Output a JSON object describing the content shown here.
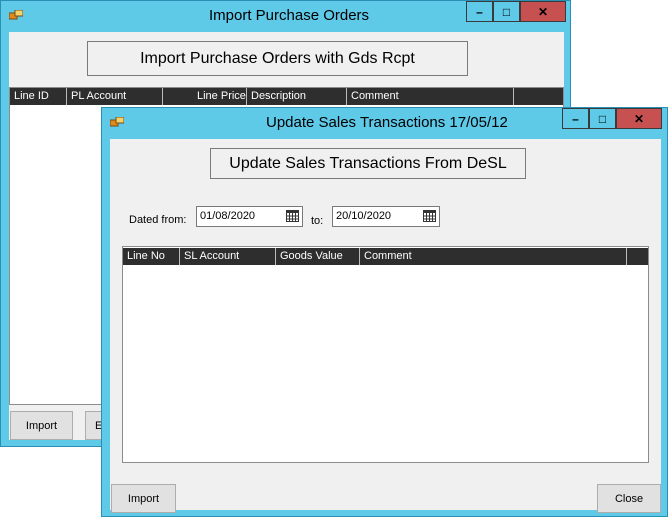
{
  "back_window": {
    "title": "Import Purchase Orders",
    "banner": "Import Purchase Orders with Gds Rcpt",
    "columns": [
      "Line ID",
      "PL Account",
      "",
      "Line Price",
      "Description",
      "Comment"
    ],
    "buttons": {
      "import": "Import",
      "export": "Ex"
    },
    "title_buttons": {
      "minimize": "–",
      "maximize": "□",
      "close": "✕"
    }
  },
  "front_window": {
    "title": "Update Sales Transactions 17/05/12",
    "banner": "Update Sales Transactions From DeSL",
    "dated_from_label": "Dated from:",
    "date_from": "01/08/2020",
    "to_label": "to:",
    "date_to": "20/10/2020",
    "columns": [
      "Line No",
      "SL Account",
      "Goods Value",
      "Comment"
    ],
    "buttons": {
      "import": "Import",
      "close": "Close"
    },
    "title_buttons": {
      "minimize": "–",
      "maximize": "□",
      "close": "✕"
    }
  }
}
